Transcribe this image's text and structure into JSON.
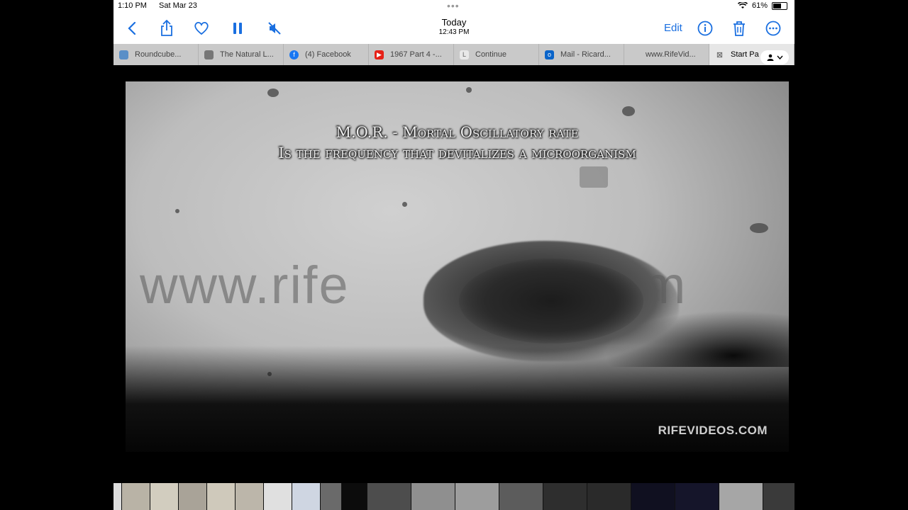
{
  "status_bar": {
    "time": "1:10 PM",
    "date": "Sat Mar 23",
    "battery": "61%",
    "battery_level": 0.61
  },
  "toolbar": {
    "title": "Today",
    "time": "12:43 PM",
    "edit_label": "Edit",
    "accent": "#1a6fe0"
  },
  "tabs": [
    {
      "label": "Roundcube...",
      "icon": "roundcube-icon"
    },
    {
      "label": "The Natural L...",
      "icon": "natural-law-icon"
    },
    {
      "label": "(4) Facebook",
      "icon": "facebook-icon"
    },
    {
      "label": "1967 Part 4 -...",
      "icon": "youtube-icon"
    },
    {
      "label": "Continue",
      "icon": "letter-l-icon"
    },
    {
      "label": "Mail - Ricard...",
      "icon": "outlook-icon"
    },
    {
      "label": "www.RifeVid...",
      "icon": "blank-icon"
    },
    {
      "label": "Start Pa",
      "icon": "close-tab-icon"
    }
  ],
  "video": {
    "subtitle_line1": "M.O.R. - Mortal Oscillatory rate",
    "subtitle_line2": "Is the frequency that devitalizes a microorganism",
    "watermark": "www.rife",
    "watermark_end": "com",
    "brand": "RIFEVIDEOS.COM"
  }
}
